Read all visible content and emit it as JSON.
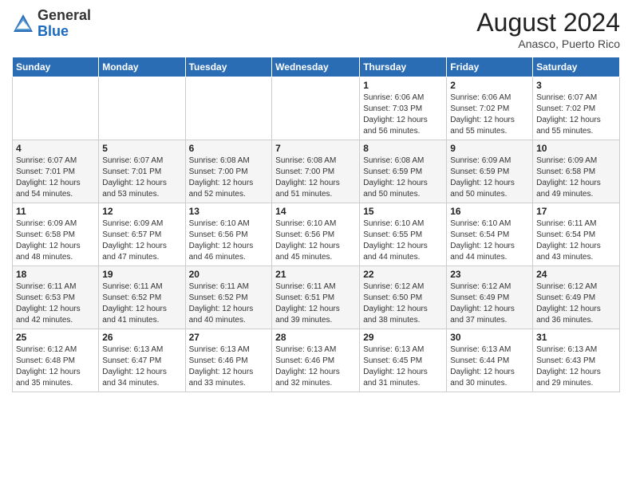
{
  "logo": {
    "general": "General",
    "blue": "Blue"
  },
  "header": {
    "month_year": "August 2024",
    "location": "Anasco, Puerto Rico"
  },
  "weekdays": [
    "Sunday",
    "Monday",
    "Tuesday",
    "Wednesday",
    "Thursday",
    "Friday",
    "Saturday"
  ],
  "weeks": [
    [
      {
        "day": "",
        "info": ""
      },
      {
        "day": "",
        "info": ""
      },
      {
        "day": "",
        "info": ""
      },
      {
        "day": "",
        "info": ""
      },
      {
        "day": "1",
        "info": "Sunrise: 6:06 AM\nSunset: 7:03 PM\nDaylight: 12 hours\nand 56 minutes."
      },
      {
        "day": "2",
        "info": "Sunrise: 6:06 AM\nSunset: 7:02 PM\nDaylight: 12 hours\nand 55 minutes."
      },
      {
        "day": "3",
        "info": "Sunrise: 6:07 AM\nSunset: 7:02 PM\nDaylight: 12 hours\nand 55 minutes."
      }
    ],
    [
      {
        "day": "4",
        "info": "Sunrise: 6:07 AM\nSunset: 7:01 PM\nDaylight: 12 hours\nand 54 minutes."
      },
      {
        "day": "5",
        "info": "Sunrise: 6:07 AM\nSunset: 7:01 PM\nDaylight: 12 hours\nand 53 minutes."
      },
      {
        "day": "6",
        "info": "Sunrise: 6:08 AM\nSunset: 7:00 PM\nDaylight: 12 hours\nand 52 minutes."
      },
      {
        "day": "7",
        "info": "Sunrise: 6:08 AM\nSunset: 7:00 PM\nDaylight: 12 hours\nand 51 minutes."
      },
      {
        "day": "8",
        "info": "Sunrise: 6:08 AM\nSunset: 6:59 PM\nDaylight: 12 hours\nand 50 minutes."
      },
      {
        "day": "9",
        "info": "Sunrise: 6:09 AM\nSunset: 6:59 PM\nDaylight: 12 hours\nand 50 minutes."
      },
      {
        "day": "10",
        "info": "Sunrise: 6:09 AM\nSunset: 6:58 PM\nDaylight: 12 hours\nand 49 minutes."
      }
    ],
    [
      {
        "day": "11",
        "info": "Sunrise: 6:09 AM\nSunset: 6:58 PM\nDaylight: 12 hours\nand 48 minutes."
      },
      {
        "day": "12",
        "info": "Sunrise: 6:09 AM\nSunset: 6:57 PM\nDaylight: 12 hours\nand 47 minutes."
      },
      {
        "day": "13",
        "info": "Sunrise: 6:10 AM\nSunset: 6:56 PM\nDaylight: 12 hours\nand 46 minutes."
      },
      {
        "day": "14",
        "info": "Sunrise: 6:10 AM\nSunset: 6:56 PM\nDaylight: 12 hours\nand 45 minutes."
      },
      {
        "day": "15",
        "info": "Sunrise: 6:10 AM\nSunset: 6:55 PM\nDaylight: 12 hours\nand 44 minutes."
      },
      {
        "day": "16",
        "info": "Sunrise: 6:10 AM\nSunset: 6:54 PM\nDaylight: 12 hours\nand 44 minutes."
      },
      {
        "day": "17",
        "info": "Sunrise: 6:11 AM\nSunset: 6:54 PM\nDaylight: 12 hours\nand 43 minutes."
      }
    ],
    [
      {
        "day": "18",
        "info": "Sunrise: 6:11 AM\nSunset: 6:53 PM\nDaylight: 12 hours\nand 42 minutes."
      },
      {
        "day": "19",
        "info": "Sunrise: 6:11 AM\nSunset: 6:52 PM\nDaylight: 12 hours\nand 41 minutes."
      },
      {
        "day": "20",
        "info": "Sunrise: 6:11 AM\nSunset: 6:52 PM\nDaylight: 12 hours\nand 40 minutes."
      },
      {
        "day": "21",
        "info": "Sunrise: 6:11 AM\nSunset: 6:51 PM\nDaylight: 12 hours\nand 39 minutes."
      },
      {
        "day": "22",
        "info": "Sunrise: 6:12 AM\nSunset: 6:50 PM\nDaylight: 12 hours\nand 38 minutes."
      },
      {
        "day": "23",
        "info": "Sunrise: 6:12 AM\nSunset: 6:49 PM\nDaylight: 12 hours\nand 37 minutes."
      },
      {
        "day": "24",
        "info": "Sunrise: 6:12 AM\nSunset: 6:49 PM\nDaylight: 12 hours\nand 36 minutes."
      }
    ],
    [
      {
        "day": "25",
        "info": "Sunrise: 6:12 AM\nSunset: 6:48 PM\nDaylight: 12 hours\nand 35 minutes."
      },
      {
        "day": "26",
        "info": "Sunrise: 6:13 AM\nSunset: 6:47 PM\nDaylight: 12 hours\nand 34 minutes."
      },
      {
        "day": "27",
        "info": "Sunrise: 6:13 AM\nSunset: 6:46 PM\nDaylight: 12 hours\nand 33 minutes."
      },
      {
        "day": "28",
        "info": "Sunrise: 6:13 AM\nSunset: 6:46 PM\nDaylight: 12 hours\nand 32 minutes."
      },
      {
        "day": "29",
        "info": "Sunrise: 6:13 AM\nSunset: 6:45 PM\nDaylight: 12 hours\nand 31 minutes."
      },
      {
        "day": "30",
        "info": "Sunrise: 6:13 AM\nSunset: 6:44 PM\nDaylight: 12 hours\nand 30 minutes."
      },
      {
        "day": "31",
        "info": "Sunrise: 6:13 AM\nSunset: 6:43 PM\nDaylight: 12 hours\nand 29 minutes."
      }
    ]
  ]
}
